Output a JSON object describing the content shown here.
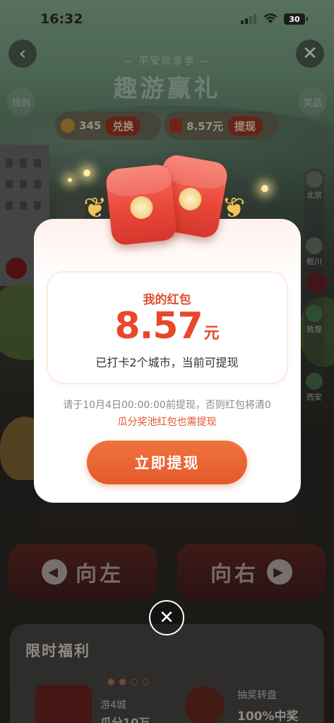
{
  "status_bar": {
    "time": "16:32",
    "battery": "30"
  },
  "header": {
    "subtitle": "— 平安欢享季 —",
    "title": "趣游赢礼",
    "left_pill": "规则",
    "right_pill": "奖品"
  },
  "stats": {
    "coins": "345",
    "exchange_label": "兑换",
    "cash": "8.57元",
    "withdraw_label": "提现"
  },
  "route": {
    "cities": [
      "北京",
      "枢川",
      "敦煌",
      "西安"
    ]
  },
  "modal": {
    "label": "我的红包",
    "amount": "8.57",
    "unit": "元",
    "description": "已打卡2个城市，当前可提现",
    "deadline_note": "请于10月4日00:00:00前提现，否则红包将清0",
    "pool_note": "瓜分奖池红包也需提现",
    "cta_label": "立即提现"
  },
  "controls": {
    "left_label": "向左",
    "right_label": "向右"
  },
  "welfare": {
    "title": "限时福利",
    "item1_line1": "游4城",
    "item1_line2": "瓜分10万",
    "item2_line1": "抽奖转盘",
    "item2_line2": "100%中奖"
  }
}
